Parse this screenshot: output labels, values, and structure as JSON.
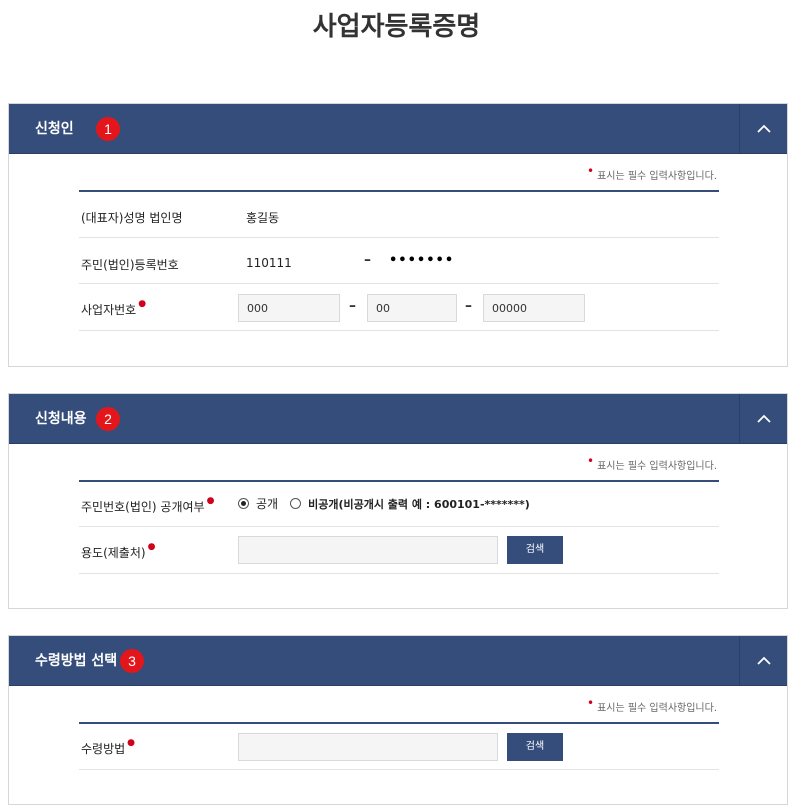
{
  "page": {
    "title": "사업자등록증명"
  },
  "required_note": "표시는 필수 입력사항입니다.",
  "section1": {
    "title": "신청인",
    "step": "1",
    "rows": {
      "name_label": "(대표자)성명 법인명",
      "name_value": "홍길동",
      "regno_label": "주민(법인)등록번호",
      "regno_front": "110111",
      "regno_back": "•••••••",
      "bizno_label": "사업자번호",
      "bizno_1": "000",
      "bizno_2": "00",
      "bizno_3": "00000"
    }
  },
  "section2": {
    "title": "신청내용",
    "step": "2",
    "rows": {
      "disclosure_label": "주민번호(법인) 공개여부",
      "option_public": "공개",
      "option_private": "비공개(비공개시 출력 예 : 600101-*******)",
      "purpose_label": "용도(제출처)",
      "purpose_value": "",
      "search_label": "검색"
    }
  },
  "section3": {
    "title": "수령방법 선택",
    "step": "3",
    "rows": {
      "method_label": "수령방법",
      "method_value": "",
      "search_label": "검색"
    }
  },
  "colors": {
    "header": "#344d7b",
    "badge": "#e3161b",
    "required": "#d0021b"
  },
  "icons": {
    "collapse": "chevron-up-icon"
  }
}
